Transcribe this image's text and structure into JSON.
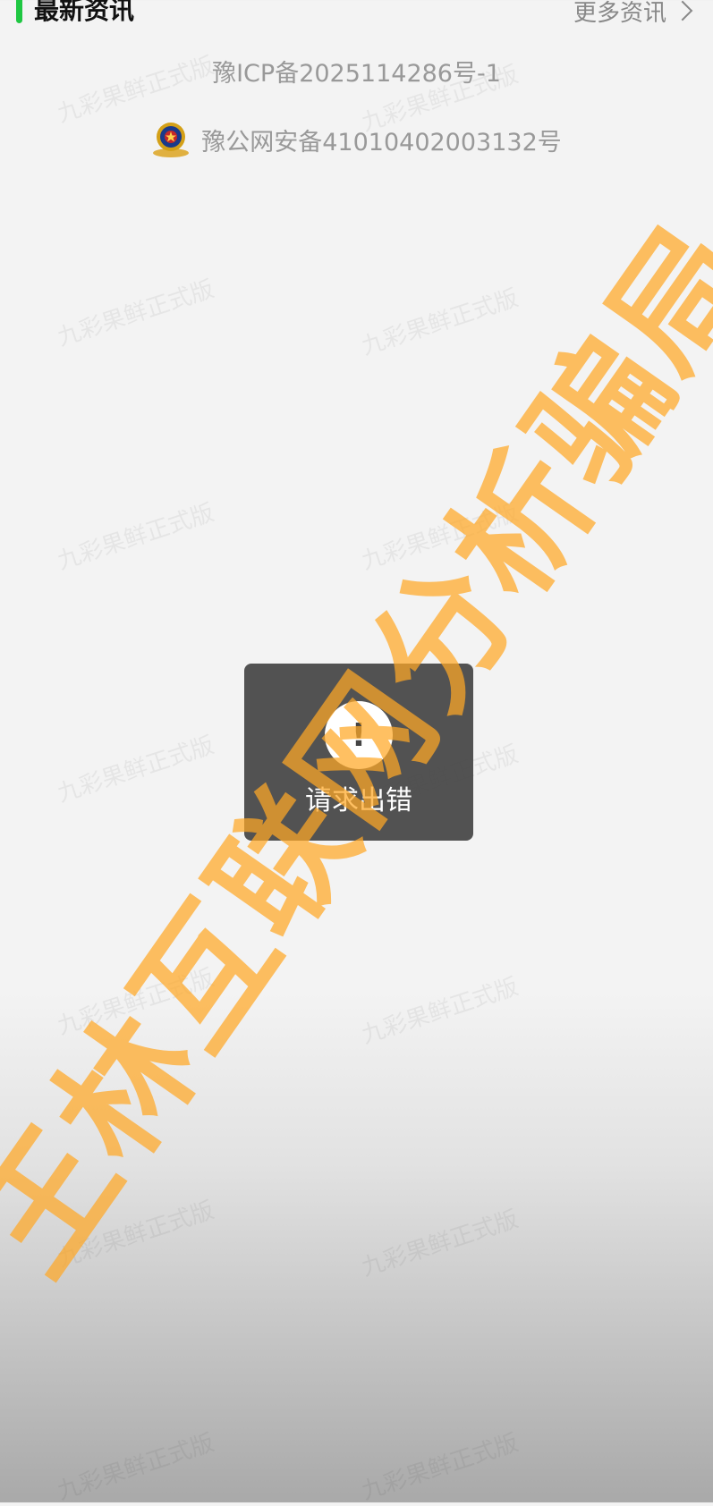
{
  "section": {
    "title": "最新资讯",
    "more_label": "更多资讯",
    "accent_color": "#1fc742"
  },
  "footer": {
    "icp": "豫ICP备2025114286号-1",
    "police": "豫公网安备41010402003132号",
    "police_icon": "police-badge-icon"
  },
  "watermark": {
    "text": "九彩果鲜正式版"
  },
  "toast": {
    "icon_symbol": "!",
    "message": "请求出错"
  },
  "overlay_stamp": {
    "text": "王林互联网分析骗局",
    "color": "#ffa726"
  }
}
